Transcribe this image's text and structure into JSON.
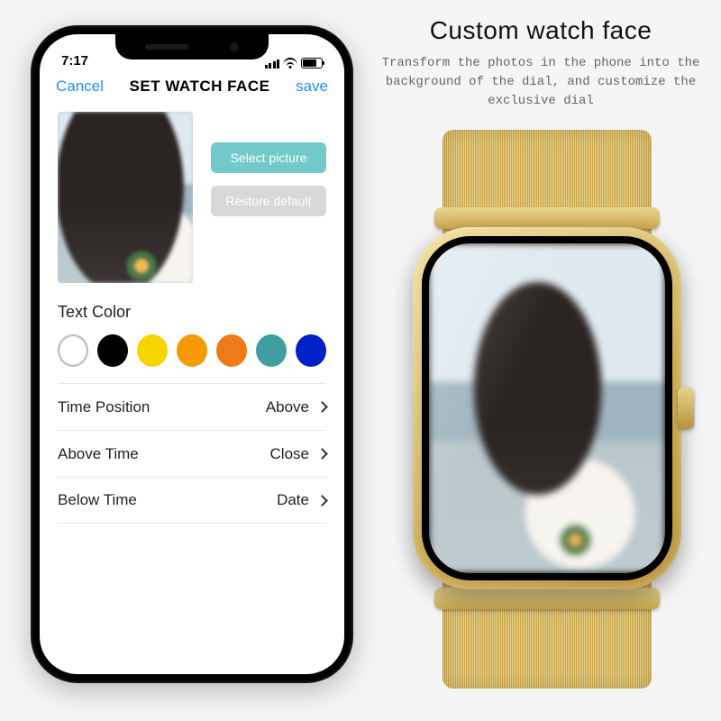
{
  "marketing": {
    "heading": "Custom watch face",
    "sub": "Transform the photos in the phone into the background of the dial, and customize the exclusive dial"
  },
  "status": {
    "time": "7:17"
  },
  "nav": {
    "cancel": "Cancel",
    "title": "SET WATCH FACE",
    "save": "save"
  },
  "buttons": {
    "select": "Select picture",
    "restore": "Restore default"
  },
  "textcolor": {
    "label": "Text Color",
    "swatches": [
      "#ffffff",
      "#000000",
      "#f5d400",
      "#f59a00",
      "#ef7a1a",
      "#3f9ea0",
      "#0020c8"
    ]
  },
  "settings": {
    "rows": [
      {
        "label": "Time Position",
        "value": "Above"
      },
      {
        "label": "Above Time",
        "value": "Close"
      },
      {
        "label": "Below Time",
        "value": "Date"
      }
    ]
  }
}
